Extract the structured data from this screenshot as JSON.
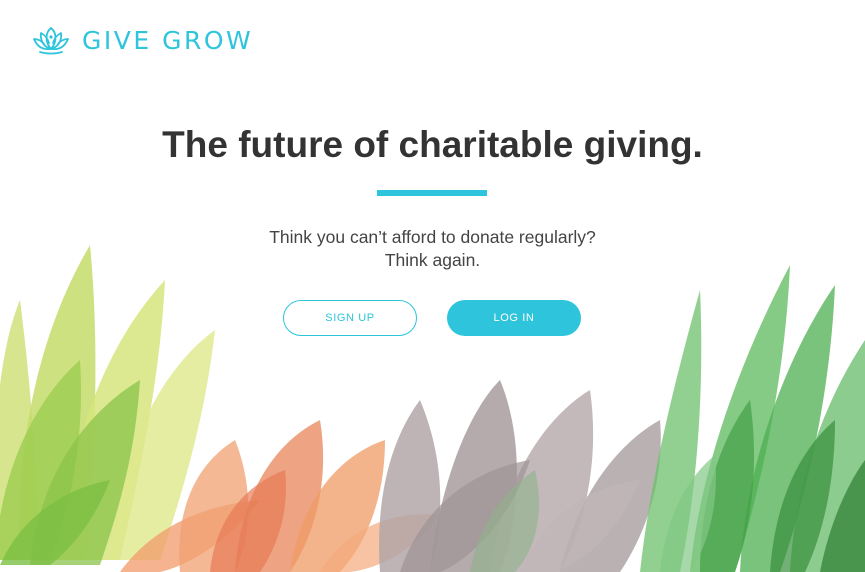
{
  "brand": {
    "name": "GIVE GROW",
    "icon": "lotus-icon",
    "color": "#2ec4dc"
  },
  "hero": {
    "headline": "The future of charitable giving.",
    "tagline_line1": "Think you can’t afford to donate regularly?",
    "tagline_line2": "Think again."
  },
  "actions": {
    "signup_label": "SIGN UP",
    "login_label": "LOG IN"
  },
  "colors": {
    "accent": "#2ec4dc",
    "heading": "#333333",
    "body_text": "#444444",
    "background": "#ffffff"
  }
}
